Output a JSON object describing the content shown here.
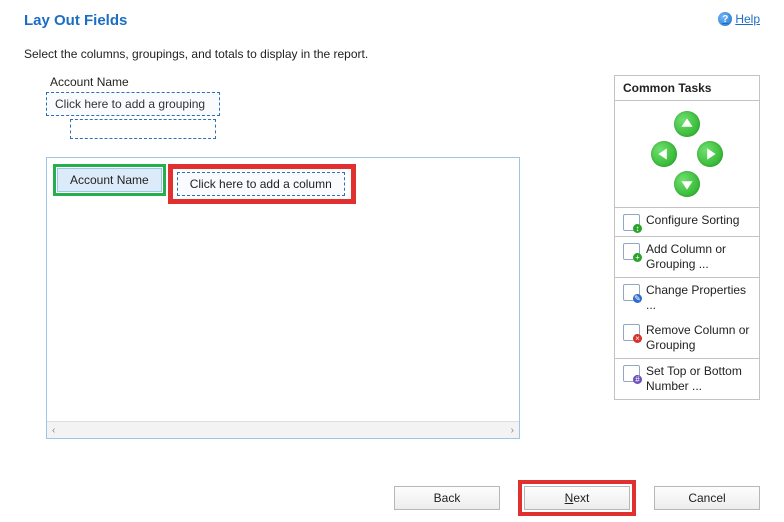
{
  "header": {
    "title": "Lay Out Fields",
    "help_label": "Help"
  },
  "instructions": "Select the columns, groupings, and totals to display in the report.",
  "layout_area": {
    "field_label": "Account Name",
    "grouping_placeholder": "Click here to add a grouping",
    "column_selected": "Account Name",
    "add_column_placeholder": "Click here to add a column"
  },
  "tasks": {
    "header": "Common Tasks",
    "items": {
      "configure_sorting": "Configure Sorting",
      "add_column_grouping": "Add Column or Grouping ...",
      "change_properties": "Change Properties ...",
      "remove_column_grouping": "Remove Column or Grouping",
      "set_top_bottom": "Set Top or Bottom Number ..."
    }
  },
  "buttons": {
    "back": "Back",
    "next": "Next",
    "cancel": "Cancel"
  }
}
